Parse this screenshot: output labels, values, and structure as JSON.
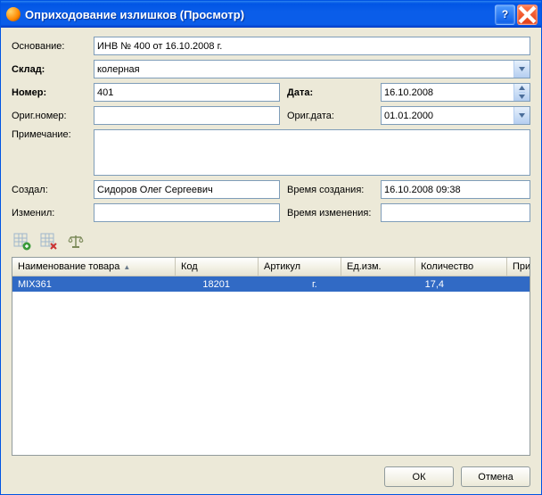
{
  "window": {
    "title": "Оприходование излишков (Просмотр)"
  },
  "labels": {
    "basis": "Основание:",
    "warehouse": "Склад:",
    "number": "Номер:",
    "date": "Дата:",
    "orig_number": "Ориг.номер:",
    "orig_date": "Ориг.дата:",
    "note": "Примечание:",
    "created_by": "Создал:",
    "created_at": "Время создания:",
    "modified_by": "Изменил:",
    "modified_at": "Время изменения:"
  },
  "values": {
    "basis": "ИНВ № 400 от 16.10.2008 г.",
    "warehouse": "колерная",
    "number": "401",
    "date": "16.10.2008",
    "orig_number": "",
    "orig_date": "01.01.2000",
    "note": "",
    "created_by": "Сидоров Олег Сергеевич",
    "created_at": "16.10.2008 09:38",
    "modified_by": "",
    "modified_at": ""
  },
  "grid": {
    "columns": {
      "name": "Наименование товара",
      "code": "Код",
      "article": "Артикул",
      "unit": "Ед.изм.",
      "qty": "Количество",
      "note": "Примечание"
    },
    "rows": [
      {
        "name": "MIX361",
        "code": "18201",
        "article": "",
        "unit": "г.",
        "qty": "17,4",
        "note": ""
      }
    ]
  },
  "buttons": {
    "ok": "ОК",
    "cancel": "Отмена"
  }
}
